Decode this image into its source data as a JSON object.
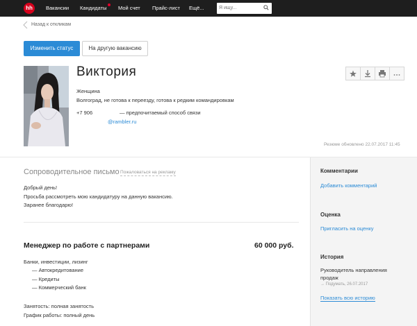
{
  "nav": {
    "logo": "hh",
    "items": [
      "Вакансии",
      "Кандидаты",
      "Мой счет",
      "Прайс-лист",
      "Ещё..."
    ],
    "search_placeholder": "Я ищу..."
  },
  "back_label": "Назад к откликам",
  "buttons": {
    "change_status": "Изменить статус",
    "other_vacancy": "На другую вакансию"
  },
  "candidate": {
    "name": "Виктория",
    "gender": "Женщина",
    "location": "Волгоград, не готова к переезду, готова к редким командировкам",
    "phone": "+7 906",
    "phone_note": "— предпочитаемый способ связи",
    "email": "@rambler.ru"
  },
  "updated": "Резюме обновлено 22.07.2017 11:45",
  "cover": {
    "title": "Сопроводительное письмо",
    "complain": "Пожаловаться на рекламу",
    "lines": [
      "Добрый день!",
      "Просьба рассмотреть мою кандидатуру на данную вакансию.",
      "Заранее благодарю!"
    ]
  },
  "position": {
    "title": "Менеджер по работе с партнерами",
    "salary": "60 000 руб.",
    "industry": "Банки, инвестиции, лизинг",
    "specializations": [
      "— Автокредитование",
      "— Кредиты",
      "— Коммерческий банк"
    ],
    "employment": "Занятость: полная занятость",
    "schedule": "График работы: полный день"
  },
  "sidebar": {
    "comments_title": "Комментарии",
    "comments_link": "Добавить комментарий",
    "rating_title": "Оценка",
    "rating_link": "Пригласить на оценку",
    "history_title": "История",
    "history_text": "Руководитель направления",
    "history_text2": "продаж",
    "history_meta": "→ Подумать, 26.07.2017",
    "history_link": "Показать всю историю"
  },
  "colors": {
    "brand": "#d6001c",
    "accent": "#2b8bd6",
    "nav_bg": "#1e1e1e"
  }
}
